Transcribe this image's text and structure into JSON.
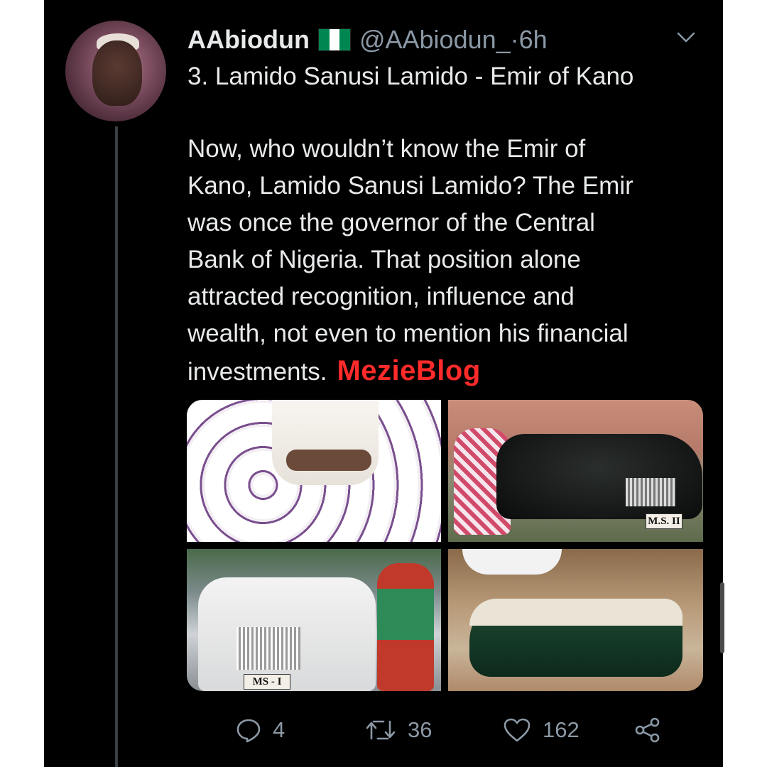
{
  "tweet": {
    "author_name": "AAbiodun",
    "handle": "@AAbiodun_",
    "time_sep": " · ",
    "time": "6h",
    "title_line": "3. Lamido Sanusi Lamido - Emir of Kano",
    "body_lines": [
      "Now, who wouldn’t know the Emir of",
      "Kano, Lamido Sanusi Lamido? The Emir",
      "was once the governor of the Central",
      "Bank of Nigeria. That position alone",
      "attracted recognition, influence and",
      "wealth, not even to mention his financial"
    ],
    "last_line": "investments.",
    "watermark": "MezieBlog",
    "flag_colors": [
      "#008751",
      "#ffffff",
      "#008751"
    ],
    "accent_watermark": "#ff2a2a"
  },
  "media": {
    "plates": {
      "black_car": "M.S. II",
      "white_car": "MS - I"
    }
  },
  "actions": {
    "replies": "4",
    "retweets": "36",
    "likes": "162",
    "icons": [
      "reply-icon",
      "retweet-icon",
      "like-icon",
      "share-icon"
    ]
  }
}
